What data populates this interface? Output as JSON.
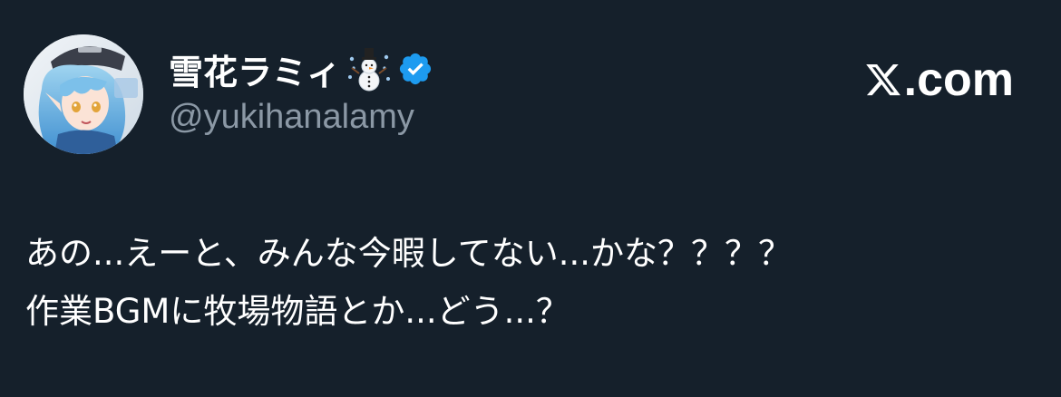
{
  "author": {
    "display_name": "雪花ラミィ",
    "name_emoji": "snowman-with-snow-icon",
    "verified": true,
    "verified_color": "#1d9bf0",
    "handle": "@yukihanalamy",
    "avatar": "avatar-illustration"
  },
  "brand": {
    "logo": "x-logo-icon",
    "label": ".com"
  },
  "tweet": {
    "lines": [
      "あの...えーと、みんな今暇してない...かな？？？？",
      "作業BGMに牧場物語とか...どう...？"
    ]
  },
  "theme": {
    "background": "#15202b",
    "text": "#ffffff",
    "secondary_text": "#8b98a5"
  }
}
